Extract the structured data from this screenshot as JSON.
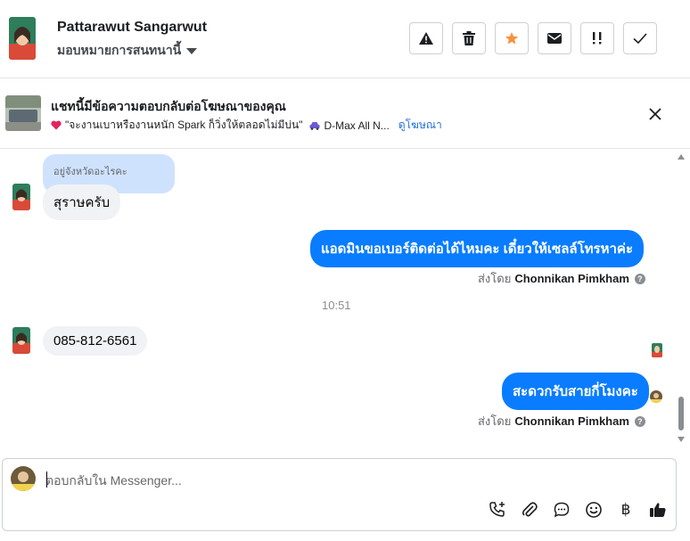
{
  "header": {
    "contact_name": "Pattarawut Sangarwut",
    "assign_label": "มอบหมายการสนทนานี้",
    "actions": [
      {
        "name": "report-spam-button",
        "icon": "warning-icon"
      },
      {
        "name": "delete-button",
        "icon": "trash-icon"
      },
      {
        "name": "star-button",
        "icon": "star-icon"
      },
      {
        "name": "mark-unread-button",
        "icon": "envelope-icon"
      },
      {
        "name": "follow-up-button",
        "icon": "exclamation-icon"
      },
      {
        "name": "mark-done-button",
        "icon": "check-icon"
      }
    ]
  },
  "ad_banner": {
    "title": "แชทนี้มีข้อความตอบกลับต่อโฆษณาของคุณ",
    "snippet": "\"จะงานเบาหรืองานหนัก Spark ก็วิ่งให้ตลอดไม่มีบ่น\"",
    "car_text": "D-Max All N...",
    "link_label": "ดูโฆษณา"
  },
  "conversation": {
    "quoted_text": "อยู่จังหวัดอะไรคะ",
    "messages": [
      {
        "direction": "in",
        "text": "สุราษครับ"
      },
      {
        "direction": "out",
        "text": "แอดมินขอเบอร์ติดต่อได้ไหมคะ เดี๋ยวให้เซลล์โทรหาค่ะ",
        "sent_by_prefix": "ส่งโดย",
        "sent_by_name": "Chonnikan Pimkham"
      },
      {
        "direction": "in",
        "text": "085-812-6561"
      },
      {
        "direction": "out",
        "text": "สะดวกรับสายกี่โมงคะ",
        "sent_by_prefix": "ส่งโดย",
        "sent_by_name": "Chonnikan Pimkham"
      }
    ],
    "timestamp": "10:51"
  },
  "composer": {
    "placeholder": "ตอบกลับใน Messenger...",
    "tools": [
      {
        "name": "add-call-button",
        "icon": "phone-plus-icon"
      },
      {
        "name": "attach-button",
        "icon": "paperclip-icon"
      },
      {
        "name": "saved-replies-button",
        "icon": "chat-bubble-icon"
      },
      {
        "name": "emoji-button",
        "icon": "smiley-icon"
      },
      {
        "name": "payment-button",
        "icon": "baht-icon",
        "glyph": "฿"
      },
      {
        "name": "like-button",
        "icon": "thumbs-up-icon"
      }
    ]
  },
  "colors": {
    "accent_blue": "#0a7cff",
    "quote_bg": "#cfe2fd",
    "incoming_bg": "#f0f2f5",
    "star_orange": "#f7923b",
    "link_blue": "#216fdb"
  }
}
